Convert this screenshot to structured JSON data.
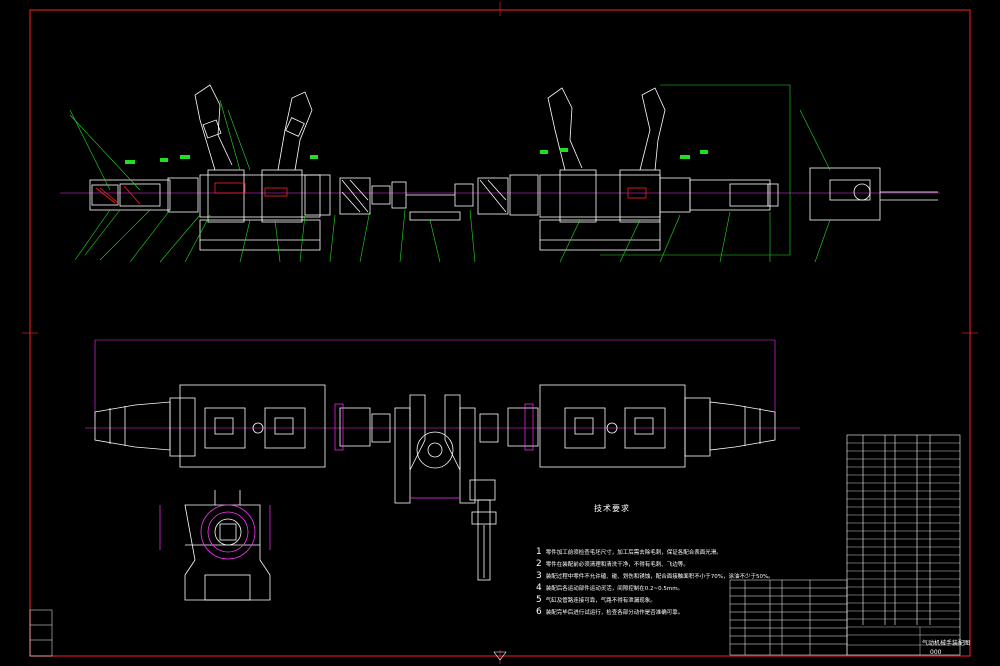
{
  "drawing": {
    "background": "#000000",
    "colors": {
      "border": "#ff2020",
      "line": "#ffffff",
      "green": "#20e020",
      "magenta": "#ff30ff",
      "red": "#ff2020",
      "cyan": "#40ffff"
    }
  },
  "notes": {
    "title": "技术要求",
    "items": [
      {
        "num": "1",
        "text": "零件加工前须检查毛坯尺寸，加工后需去除毛刺，保证各配合表面光滑。"
      },
      {
        "num": "2",
        "text": "零件在装配前必须清理和清洗干净，不得有毛刺、飞边等。"
      },
      {
        "num": "3",
        "text": "装配过程中零件不允许磕、碰、划伤和锈蚀，配合面接触面积不小于70%，涂油不少于50%。"
      },
      {
        "num": "4",
        "text": "装配后各运动部件运动灵活，间隙控制在0.2~0.5mm。"
      },
      {
        "num": "5",
        "text": "气缸及管路连接可靠，气路不得有泄漏现象。"
      },
      {
        "num": "6",
        "text": "装配完毕后进行试运行，检查各部分动作是否准确可靠。"
      }
    ]
  },
  "title_block": {
    "name": "气动机械手装配图",
    "code": "000"
  }
}
